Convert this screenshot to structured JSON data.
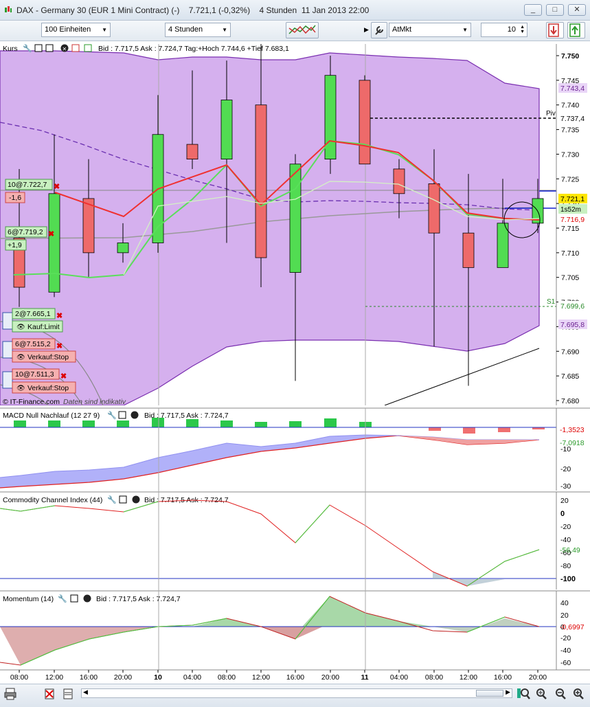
{
  "window": {
    "title": "DAX - Germany 30 (EUR 1 Mini Contract) (-)    7.721,1 (-0,32%)    4 Stunden  11 Jan 2013 22:00",
    "buttons": [
      "_",
      "□",
      "✕"
    ]
  },
  "toolbar": {
    "quantity": "100 Einheiten",
    "timeframe": "4 Stunden",
    "order_type": "AtMkt",
    "amount": "10"
  },
  "main_panel": {
    "header_label": "Kurs",
    "info": "Bid : 7.717,5 Ask : 7.724,7 Tag:+Hoch 7.744,6 +Tief 7.683,1",
    "y_ticks": [
      "7.750",
      "7.745",
      "7.740",
      "7.735",
      "7.730",
      "7.725",
      "7.720",
      "7.715",
      "7.710",
      "7.705",
      "7.700",
      "7.695",
      "7.690",
      "7.685",
      "7.680"
    ],
    "price_tags": {
      "upper_band": "7.743,4",
      "pivot": "7.737,4",
      "last": "7.721,1",
      "countdown": "1s52m",
      "ma": "7.716,9",
      "s1": "7.699,6",
      "lower_band": "7.695,8"
    },
    "line_labels": {
      "pivot": "Piv",
      "s1": "S1"
    },
    "orders": [
      {
        "label": "10@7.722,7",
        "pl": "-1,6"
      },
      {
        "label": "6@7.719,2",
        "pl": "+1,9"
      },
      {
        "label": "2@7.665,1",
        "type": "Kauf:Limit"
      },
      {
        "label": "6@7.515,2",
        "type": "Verkauf:Stop"
      },
      {
        "label": "10@7.511,3",
        "type": "Verkauf:Stop"
      }
    ],
    "footer": "© IT-Finance.com",
    "footer_note": "Daten sind indikativ"
  },
  "macd_panel": {
    "title": "MACD Null Nachlauf (12 27 9)",
    "info": "Bid : 7.717,5 Ask : 7.724,7",
    "y_ticks": [
      "-10",
      "-20",
      "-30"
    ],
    "tag_signal": "-1,3523",
    "tag_macd": "-7,0918"
  },
  "cci_panel": {
    "title": "Commodity Channel Index (44)",
    "info": "Bid : 7.717,5 Ask : 7.724,7",
    "y_ticks": [
      "20",
      "0",
      "-20",
      "-40",
      "-60",
      "-80",
      "-100"
    ],
    "tag": "-56,49"
  },
  "momentum_panel": {
    "title": "Momentum (14)",
    "info": "Bid : 7.717,5 Ask : 7.724,7",
    "y_ticks": [
      "40",
      "20",
      "0",
      "-20",
      "-40",
      "-60"
    ],
    "tag": "-0,6997"
  },
  "x_axis": [
    "08:00",
    "12:00",
    "16:00",
    "20:00",
    "10",
    "04:00",
    "08:00",
    "12:00",
    "16:00",
    "20:00",
    "11",
    "04:00",
    "08:00",
    "12:00",
    "16:00",
    "20:00"
  ],
  "chart_data": {
    "type": "candlestick",
    "candles": [
      {
        "o": 7713,
        "h": 7727,
        "l": 7699,
        "c": 7703
      },
      {
        "o": 7702,
        "h": 7734,
        "l": 7701,
        "c": 7722
      },
      {
        "o": 7721,
        "h": 7729,
        "l": 7705,
        "c": 7710
      },
      {
        "o": 7710,
        "h": 7716,
        "l": 7708,
        "c": 7712
      },
      {
        "o": 7712,
        "h": 7742,
        "l": 7710,
        "c": 7734
      },
      {
        "o": 7732,
        "h": 7747,
        "l": 7727,
        "c": 7729
      },
      {
        "o": 7729,
        "h": 7749,
        "l": 7712,
        "c": 7741
      },
      {
        "o": 7740,
        "h": 7754,
        "l": 7703,
        "c": 7709
      },
      {
        "o": 7706,
        "h": 7730,
        "l": 7684,
        "c": 7728
      },
      {
        "o": 7729,
        "h": 7750,
        "l": 7726,
        "c": 7746
      },
      {
        "o": 7745,
        "h": 7746,
        "l": 7728,
        "c": 7728
      },
      {
        "o": 7727,
        "h": 7729,
        "l": 7717,
        "c": 7722
      },
      {
        "o": 7724,
        "h": 7731,
        "l": 7691,
        "c": 7714
      },
      {
        "o": 7714,
        "h": 7726,
        "l": 7683,
        "c": 7707
      },
      {
        "o": 7707,
        "h": 7725,
        "l": 7707,
        "c": 7716
      },
      {
        "o": 7716,
        "h": 7725,
        "l": 7714,
        "c": 7721
      }
    ],
    "ylim": [
      7680,
      7752
    ]
  }
}
